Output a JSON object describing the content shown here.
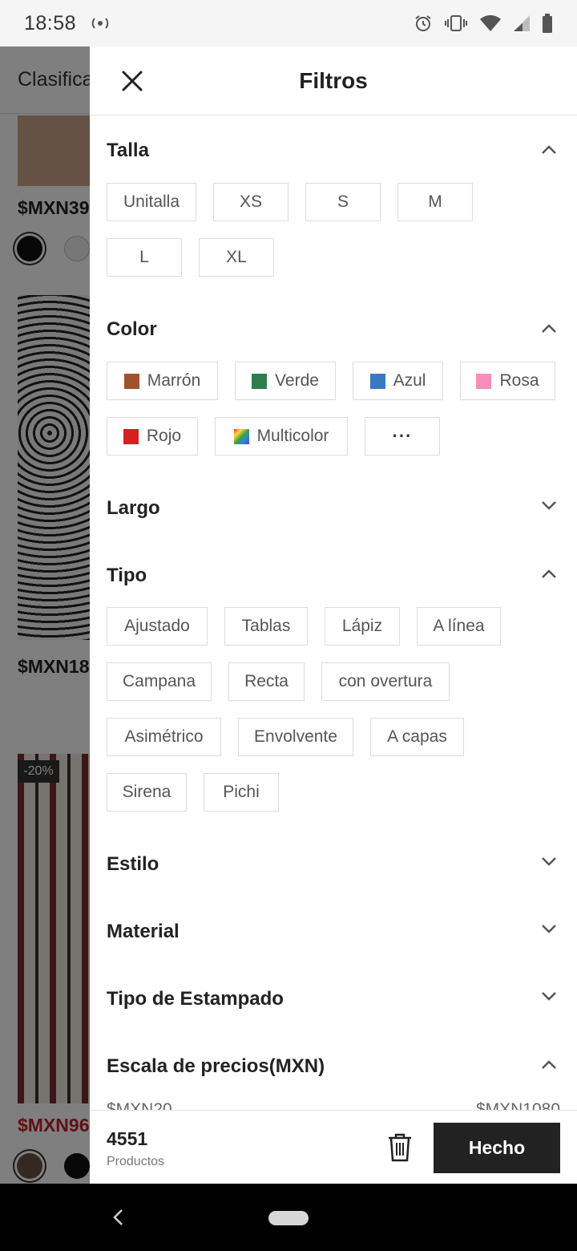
{
  "status_bar": {
    "time": "18:58",
    "icons": [
      "hotspot-icon",
      "alarm-icon",
      "vibrate-icon",
      "wifi-icon",
      "signal-icon",
      "battery-icon"
    ]
  },
  "background": {
    "header_label": "Clasifica",
    "prices": [
      "$MXN39",
      "$MXN18",
      "$MXN96"
    ],
    "discount_badge": "-20%"
  },
  "panel": {
    "title": "Filtros",
    "sections": {
      "talla": {
        "title": "Talla",
        "expanded": true,
        "options": [
          "Unitalla",
          "XS",
          "S",
          "M",
          "L",
          "XL"
        ]
      },
      "color": {
        "title": "Color",
        "expanded": true,
        "options": [
          {
            "label": "Marrón",
            "color": "#a0522d"
          },
          {
            "label": "Verde",
            "color": "#2e7d4f"
          },
          {
            "label": "Azul",
            "color": "#3a78c2"
          },
          {
            "label": "Rosa",
            "color": "#f78fb8"
          },
          {
            "label": "Rojo",
            "color": "#d62020"
          },
          {
            "label": "Multicolor",
            "color": "multicolor"
          }
        ],
        "more_label": "···"
      },
      "largo": {
        "title": "Largo",
        "expanded": false
      },
      "tipo": {
        "title": "Tipo",
        "expanded": true,
        "options": [
          "Ajustado",
          "Tablas",
          "Lápiz",
          "A línea",
          "Campana",
          "Recta",
          "con overtura",
          "Asimétrico",
          "Envolvente",
          "A capas",
          "Sirena",
          "Pichi"
        ]
      },
      "estilo": {
        "title": "Estilo",
        "expanded": false
      },
      "material": {
        "title": "Material",
        "expanded": false
      },
      "estampado": {
        "title": "Tipo de Estampado",
        "expanded": false
      },
      "precios": {
        "title": "Escala de precios(MXN)",
        "expanded": true,
        "min_label": "$MXN20",
        "max_label": "$MXN1080"
      }
    }
  },
  "footer": {
    "count": "4551",
    "count_label": "Productos",
    "done_label": "Hecho"
  }
}
